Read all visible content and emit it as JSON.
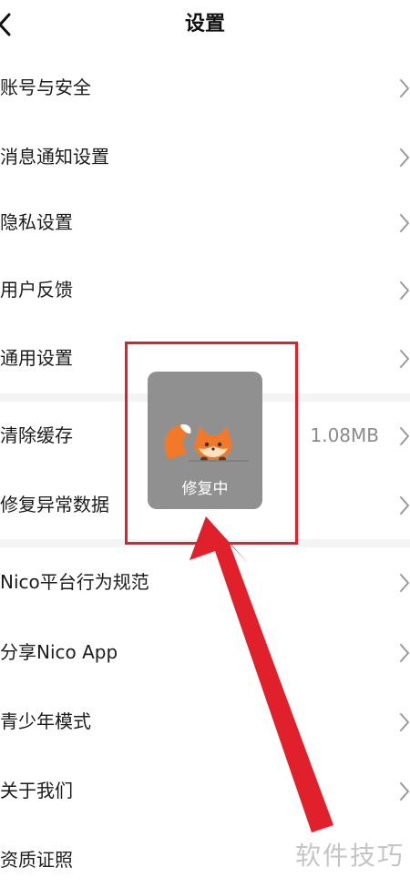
{
  "header": {
    "title": "设置",
    "back_icon": "chevron-left-icon"
  },
  "settings": {
    "account_security": "账号与安全",
    "notification_settings": "消息通知设置",
    "privacy_settings": "隐私设置",
    "user_feedback": "用户反馈",
    "general_settings": "通用设置",
    "clear_cache": "清除缓存",
    "cache_size": "1.08MB",
    "repair_data": "修复异常数据",
    "nico_rules": "Nico平台行为规范",
    "share_app": "分享Nico App",
    "youth_mode": "青少年模式",
    "about_us": "关于我们",
    "qualifications": "资质证照"
  },
  "toast": {
    "text": "修复中",
    "icon": "fox-mascot-icon",
    "background": "#909090"
  },
  "annotation": {
    "color": "#e0202a"
  },
  "watermark": {
    "text": "软件技巧"
  },
  "colors": {
    "divider": "#f4f4f4",
    "chevron": "#999999"
  }
}
